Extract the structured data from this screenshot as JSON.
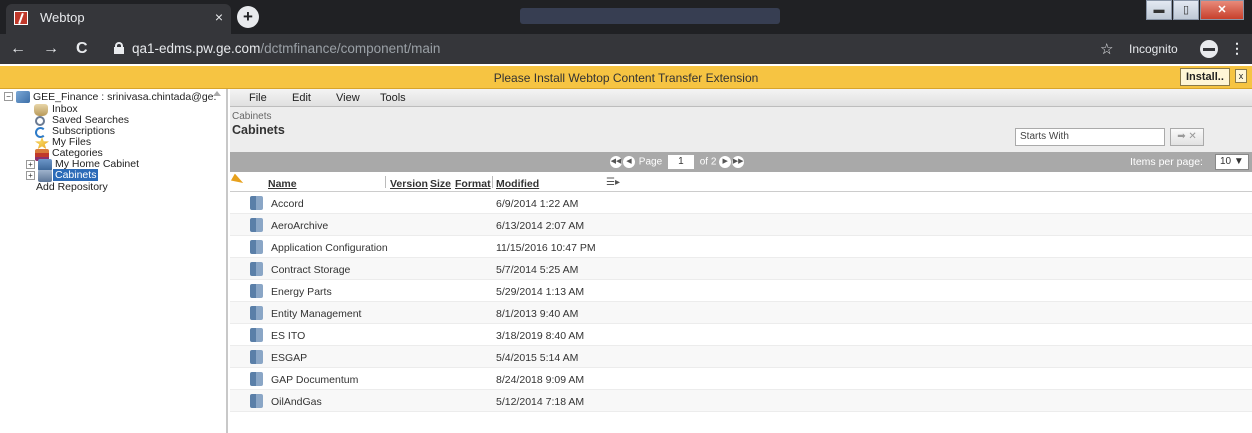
{
  "browser": {
    "tab_title": "Webtop",
    "tab_close": "×",
    "new_tab": "+",
    "url_host": "qa1-edms.pw.ge.com",
    "url_path": "/dctmfinance/component/main",
    "incognito_label": "Incognito",
    "back": "←",
    "forward": "→",
    "reload": "C",
    "star": "☆",
    "menu": "⋮"
  },
  "window_buttons": {
    "minimize": "▬",
    "maximize": "▯",
    "close": "✕"
  },
  "banner": {
    "text": "Please Install Webtop Content Transfer Extension",
    "install_label": "Install..",
    "close_label": "x"
  },
  "tree": {
    "root_label": "GEE_Finance : srinivasa.chintada@ge.",
    "items": [
      {
        "label": "Inbox",
        "icon": "inbox-icon"
      },
      {
        "label": "Saved Searches",
        "icon": "saved-searches-icon"
      },
      {
        "label": "Subscriptions",
        "icon": "subscriptions-icon"
      },
      {
        "label": "My Files",
        "icon": "my-files-icon"
      },
      {
        "label": "Categories",
        "icon": "categories-icon"
      },
      {
        "label": "My Home Cabinet",
        "icon": "home-cabinet-icon"
      },
      {
        "label": "Cabinets",
        "icon": "cabinets-icon",
        "selected": true
      }
    ],
    "add_repository": "Add Repository"
  },
  "menu": {
    "file": "File",
    "edit": "Edit",
    "view": "View",
    "tools": "Tools"
  },
  "header": {
    "breadcrumb": "Cabinets",
    "title": "Cabinets",
    "search_value": "Starts With"
  },
  "pager": {
    "page_label": "Page",
    "page_value": "1",
    "of_label": "of 2",
    "items_per_page_label": "Items per page:",
    "items_per_page_value": "10"
  },
  "columns": {
    "name": "Name",
    "version": "Version",
    "size": "Size",
    "format": "Format",
    "modified": "Modified"
  },
  "rows": [
    {
      "name": "Accord",
      "modified": "6/9/2014 1:22 AM"
    },
    {
      "name": "AeroArchive",
      "modified": "6/13/2014 2:07 AM"
    },
    {
      "name": "Application Configuration",
      "modified": "11/15/2016 10:47 PM"
    },
    {
      "name": "Contract Storage",
      "modified": "5/7/2014 5:25 AM"
    },
    {
      "name": "Energy Parts",
      "modified": "5/29/2014 1:13 AM"
    },
    {
      "name": "Entity Management",
      "modified": "8/1/2013 9:40 AM"
    },
    {
      "name": "ES ITO",
      "modified": "3/18/2019 8:40 AM"
    },
    {
      "name": "ESGAP",
      "modified": "5/4/2015 5:14 AM"
    },
    {
      "name": "GAP Documentum",
      "modified": "8/24/2018 9:09 AM"
    },
    {
      "name": "OilAndGas",
      "modified": "5/12/2014 7:18 AM"
    }
  ]
}
